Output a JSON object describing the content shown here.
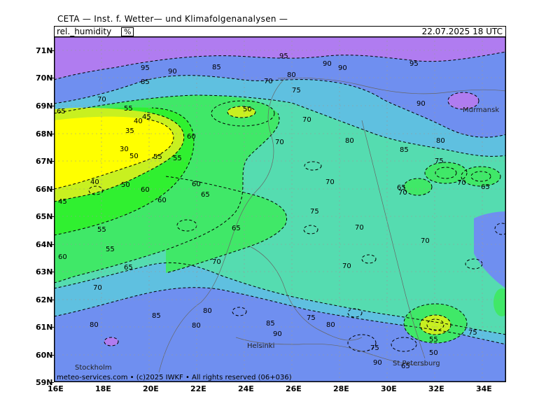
{
  "header": {
    "title": "CETA — Inst. f. Wetter— und Klimafolgenanalysen —",
    "variable": "rel._humidity",
    "unit": "%",
    "valid_time": "22.07.2025  18 UTC"
  },
  "footer": {
    "credit": "meteo-services.com • (c)2025 IWKF • All rights reserved (06+036)"
  },
  "axes": {
    "lat_labels": [
      "71N",
      "70N",
      "69N",
      "68N",
      "67N",
      "66N",
      "65N",
      "64N",
      "63N",
      "62N",
      "61N",
      "60N",
      "59N"
    ],
    "lon_labels": [
      "16E",
      "18E",
      "20E",
      "22E",
      "24E",
      "26E",
      "28E",
      "30E",
      "32E",
      "34E"
    ]
  },
  "places": [
    {
      "name": "Murmansk"
    },
    {
      "name": "Helsinki"
    },
    {
      "name": "Stockholm"
    },
    {
      "name": "St.Petersburg"
    }
  ],
  "contour_labels": [
    "95",
    "90",
    "85",
    "80",
    "75",
    "70",
    "65",
    "60",
    "55",
    "50",
    "45",
    "40",
    "35",
    "30"
  ],
  "colors": {
    "very_moist": "#b07cf0",
    "moist_blue": "#6f8ff0",
    "blue_teal": "#5fc0e0",
    "teal": "#55dcb0",
    "green": "#40e868",
    "bright_green": "#30f030",
    "yellow_green": "#c8f020",
    "yellow": "#ffff00",
    "contour": "#000000"
  }
}
